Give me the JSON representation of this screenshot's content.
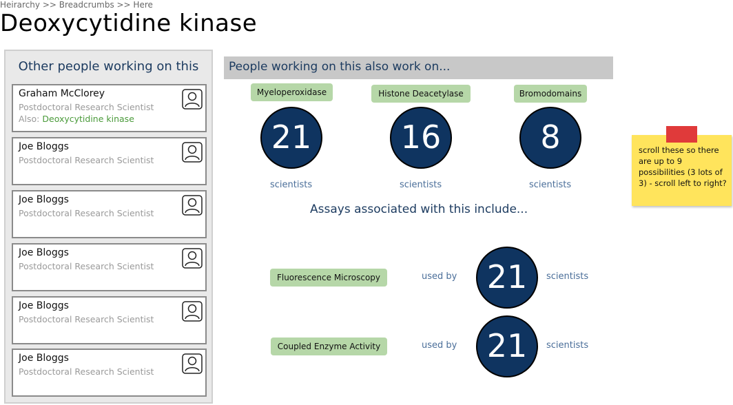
{
  "breadcrumb": "Heirarchy >> Breadcrumbs >> Here",
  "title": "Deoxycytidine kinase",
  "sidebar": {
    "heading": "Other people working on this",
    "people": [
      {
        "name": "Graham McClorey",
        "role": "Postdoctoral Research Scientist",
        "also_label": "Also: ",
        "also_value": "Deoxycytidine kinase"
      },
      {
        "name": "Joe Bloggs",
        "role": "Postdoctoral Research Scientist"
      },
      {
        "name": "Joe Bloggs",
        "role": "Postdoctoral Research Scientist"
      },
      {
        "name": "Joe Bloggs",
        "role": "Postdoctoral Research Scientist"
      },
      {
        "name": "Joe Bloggs",
        "role": "Postdoctoral Research Scientist"
      },
      {
        "name": "Joe Bloggs",
        "role": "Postdoctoral Research Scientist"
      }
    ]
  },
  "also_work": {
    "heading": "People working on this also work on...",
    "items": [
      {
        "tag": "Myeloperoxidase",
        "count": "21",
        "unit": "scientists"
      },
      {
        "tag": "Histone Deacetylase",
        "count": "16",
        "unit": "scientists"
      },
      {
        "tag": "Bromodomains",
        "count": "8",
        "unit": "scientists"
      }
    ]
  },
  "assays": {
    "heading": "Assays associated with this include...",
    "items": [
      {
        "tag": "Fluorescence Microscopy",
        "used_by": "used by",
        "count": "21",
        "unit": "scientists"
      },
      {
        "tag": "Coupled Enzyme Activity",
        "used_by": "used by",
        "count": "21",
        "unit": "scientists"
      }
    ]
  },
  "sticky_note": "scroll these so there are up to 9 possibilities (3 lots of 3) - scroll left to right?",
  "colors": {
    "accent_navy": "#0f3460",
    "tag_green": "#b6d7a8",
    "sticky_yellow": "#ffe45c"
  }
}
